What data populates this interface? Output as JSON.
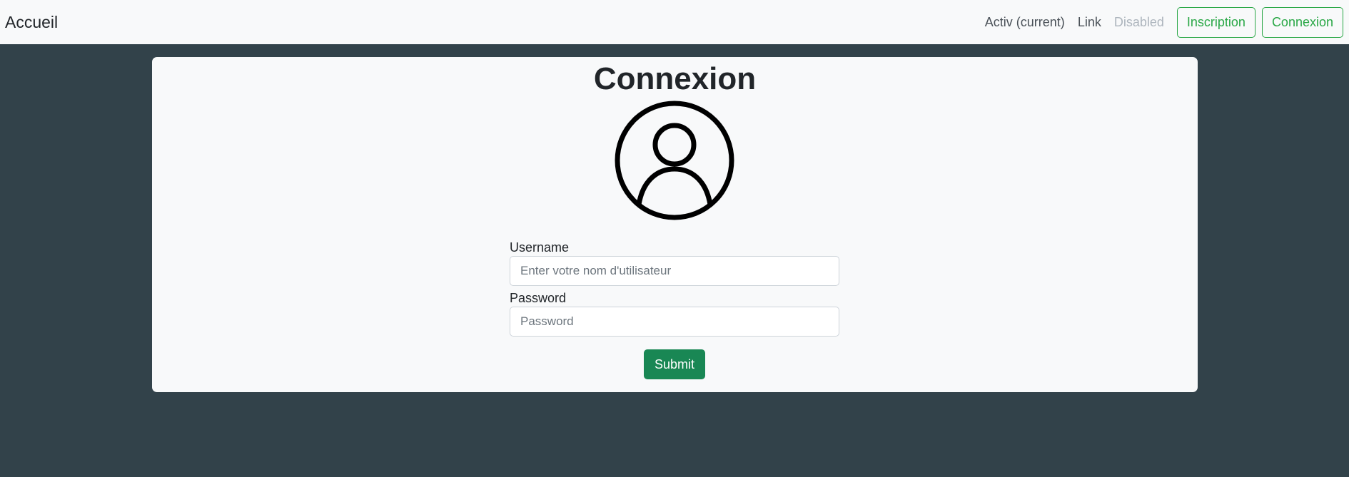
{
  "navbar": {
    "brand": "Accueil",
    "links": {
      "active": "Activ (current)",
      "link": "Link",
      "disabled": "Disabled"
    },
    "buttons": {
      "inscription": "Inscription",
      "connexion": "Connexion"
    },
    "accent_color": "#28a745"
  },
  "card": {
    "title": "Connexion",
    "avatar_icon": "person-circle-icon",
    "form": {
      "username_label": "Username",
      "username_value": "",
      "username_placeholder": "Enter votre nom d'utilisateur",
      "password_label": "Password",
      "password_value": "",
      "password_placeholder": "Password",
      "submit_label": "Submit"
    }
  },
  "colors": {
    "page_background": "#32424a",
    "card_background": "#f8f9fa",
    "submit_background": "#198754"
  }
}
